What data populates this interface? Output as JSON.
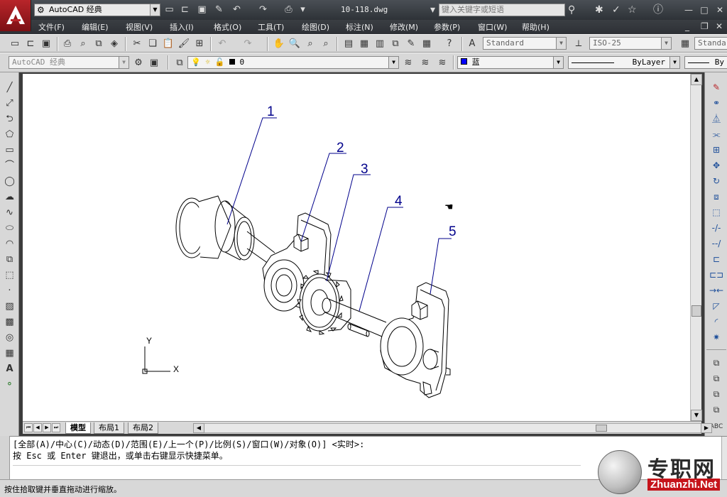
{
  "title_bar": {
    "workspace": "AutoCAD 经典",
    "document_title": "10-118.dwg",
    "search_placeholder": "键入关键字或短语"
  },
  "menu": [
    "文件(F)",
    "编辑(E)",
    "视图(V)",
    "插入(I)",
    "格式(O)",
    "工具(T)",
    "绘图(D)",
    "标注(N)",
    "修改(M)",
    "参数(P)",
    "窗口(W)",
    "帮助(H)"
  ],
  "toolbar": {
    "text_style": "Standard",
    "dim_style": "ISO-25",
    "table_style": "Standa",
    "workspace": "AutoCAD 经典",
    "layer": "0",
    "color": "蓝",
    "color_value": "#0000ff",
    "linetype": "ByLayer",
    "lineweight": "By"
  },
  "drawing": {
    "balloons": [
      "1",
      "2",
      "3",
      "4",
      "5"
    ],
    "ucs": {
      "x": "X",
      "y": "Y"
    },
    "line_color": "#000000",
    "leader_color": "#00008b"
  },
  "layout_tabs": [
    "模型",
    "布局1",
    "布局2"
  ],
  "command": {
    "line1": "[全部(A)/中心(C)/动态(D)/范围(E)/上一个(P)/比例(S)/窗口(W)/对象(O)] <实时>:",
    "line2": "按 Esc 或 Enter 键退出，或单击右键显示快捷菜单。",
    "input": ""
  },
  "status_bar": {
    "text": "按住拾取键并垂直拖动进行缩放。"
  },
  "watermark": {
    "chinese": "专职网",
    "english": "Zhuanzhi.Net"
  }
}
